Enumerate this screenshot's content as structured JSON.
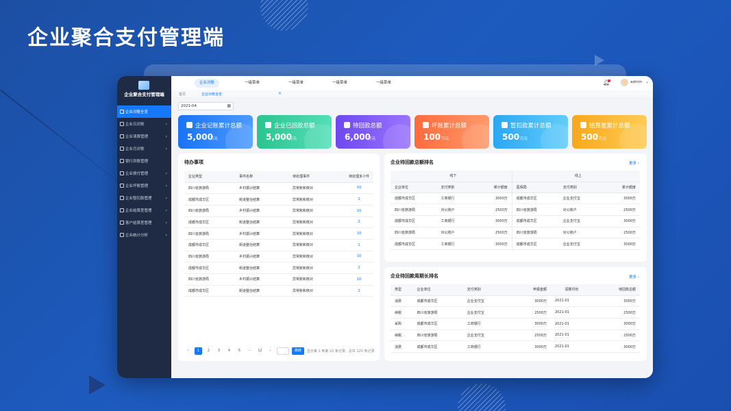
{
  "hero": {
    "title": "企业聚合支付管理端"
  },
  "app": {
    "name": "企业聚合支付管理端"
  },
  "sidebar": {
    "items": [
      {
        "label": "企业对账全览",
        "active": true
      },
      {
        "label": "企业日对账"
      },
      {
        "label": "企业清算管理"
      },
      {
        "label": "企业月对账"
      },
      {
        "label": "银行到账管理"
      },
      {
        "label": "企业拨付管理"
      },
      {
        "label": "企业坏账管理"
      },
      {
        "label": "企业暂扣款管理"
      },
      {
        "label": "企业结算差管理"
      },
      {
        "label": "客户结算差管理"
      },
      {
        "label": "企业统计分析"
      }
    ]
  },
  "topbar": {
    "tabs": [
      "企业对账",
      "一级菜单",
      "一级菜单",
      "一级菜单",
      "一级菜单"
    ],
    "user": "admin"
  },
  "breadcrumb": {
    "home": "首页",
    "current": "企业对账全览"
  },
  "filter": {
    "date": "2021-04"
  },
  "cards": [
    {
      "label": "企业记账累计总额",
      "value": "5,000",
      "unit": "万元",
      "color": "#1a73f5"
    },
    {
      "label": "企业已回款总额",
      "value": "5,000",
      "unit": "万元",
      "color": "#2fcb9a"
    },
    {
      "label": "待回款总额",
      "value": "6,000",
      "unit": "万元",
      "color": "#7b52f0"
    },
    {
      "label": "坏账累计总额",
      "value": "100",
      "unit": "万元",
      "color": "#ff7a45"
    },
    {
      "label": "暂扣款累计总额",
      "value": "500",
      "unit": "万元",
      "color": "#3ab0f5"
    },
    {
      "label": "结算差累计总额",
      "value": "500",
      "unit": "万元",
      "color": "#fbb52a"
    }
  ],
  "todo": {
    "title": "待办事项",
    "columns": [
      "企业类型",
      "事件名称",
      "待处理事件",
      "待处理多少件"
    ],
    "rows": [
      [
        "四川省旅游局",
        "乡村振兴结算",
        "异常账和核对",
        "10"
      ],
      [
        "成都市成华区",
        "街道整治结算",
        "异常账和核对",
        "2"
      ],
      [
        "四川省旅游局",
        "乡村振兴结算",
        "异常账和核对",
        "10"
      ],
      [
        "成都市成华区",
        "街道整治结算",
        "异常账和核对",
        "2"
      ],
      [
        "四川省旅游局",
        "乡村振兴结算",
        "异常账和核对",
        "10"
      ],
      [
        "成都市成华区",
        "街道整治结算",
        "异常账和核对",
        "2"
      ],
      [
        "四川省旅游局",
        "乡村振兴结算",
        "异常账和核对",
        "10"
      ],
      [
        "成都市成华区",
        "街道整治结算",
        "异常账和核对",
        "2"
      ],
      [
        "四川省旅游局",
        "乡村振兴结算",
        "异常账和核对",
        "10"
      ],
      [
        "成都市成华区",
        "街道整治结算",
        "异常账和核对",
        "2"
      ]
    ],
    "pager": {
      "pages": [
        "1",
        "2",
        "3",
        "4",
        "5",
        "···",
        "12"
      ],
      "jump": "跳转",
      "info": "显示第 1 到第 10 条记录，总共 120 条记录"
    }
  },
  "ranking": {
    "title": "企业待回款总额排名",
    "more": "更多",
    "groups": [
      "线下",
      "线上"
    ],
    "columns": [
      "企业单位",
      "支付类别",
      "累计额度",
      "医保局",
      "支付类别",
      "累计额度"
    ],
    "rows": [
      [
        "成都市成华区",
        "工商银行",
        "3000万",
        "成都市成华区",
        "企业支付宝",
        "3000万"
      ],
      [
        "四川省旅游局",
        "对公账户",
        "2500万",
        "四川省旅游局",
        "对公账户",
        "2500万"
      ],
      [
        "成都市成华区",
        "工商银行",
        "3000万",
        "成都市成华区",
        "企业支付宝",
        "3000万"
      ],
      [
        "四川省旅游局",
        "对公账户",
        "2500万",
        "四川省旅游局",
        "对公账户",
        "2500万"
      ],
      [
        "成都市成华区",
        "工商银行",
        "3000万",
        "成都市成华区",
        "企业支付宝",
        "3000万"
      ]
    ]
  },
  "cycle": {
    "title": "企业待回款周期长排名",
    "more": "更多",
    "columns": [
      "类型",
      "企业单位",
      "支付类别",
      "申报金额",
      "清算月份",
      "待回款总额"
    ],
    "rows": [
      [
        "消费",
        "成都市成华区",
        "企业支付宝",
        "3000万",
        "2021-01",
        "3000万"
      ],
      [
        "纳税",
        "四川省旅游局",
        "企业支付宝",
        "2500万",
        "2021-01",
        "2500万"
      ],
      [
        "采购",
        "成都市成华区",
        "工商银行",
        "3000万",
        "2021-01",
        "3000万"
      ],
      [
        "纳税",
        "四川省旅游局",
        "企业支付宝",
        "2500万",
        "2021-01",
        "2500万"
      ],
      [
        "消费",
        "成都市成华区",
        "工商银行",
        "3000万",
        "2021-01",
        "3000万"
      ]
    ]
  }
}
